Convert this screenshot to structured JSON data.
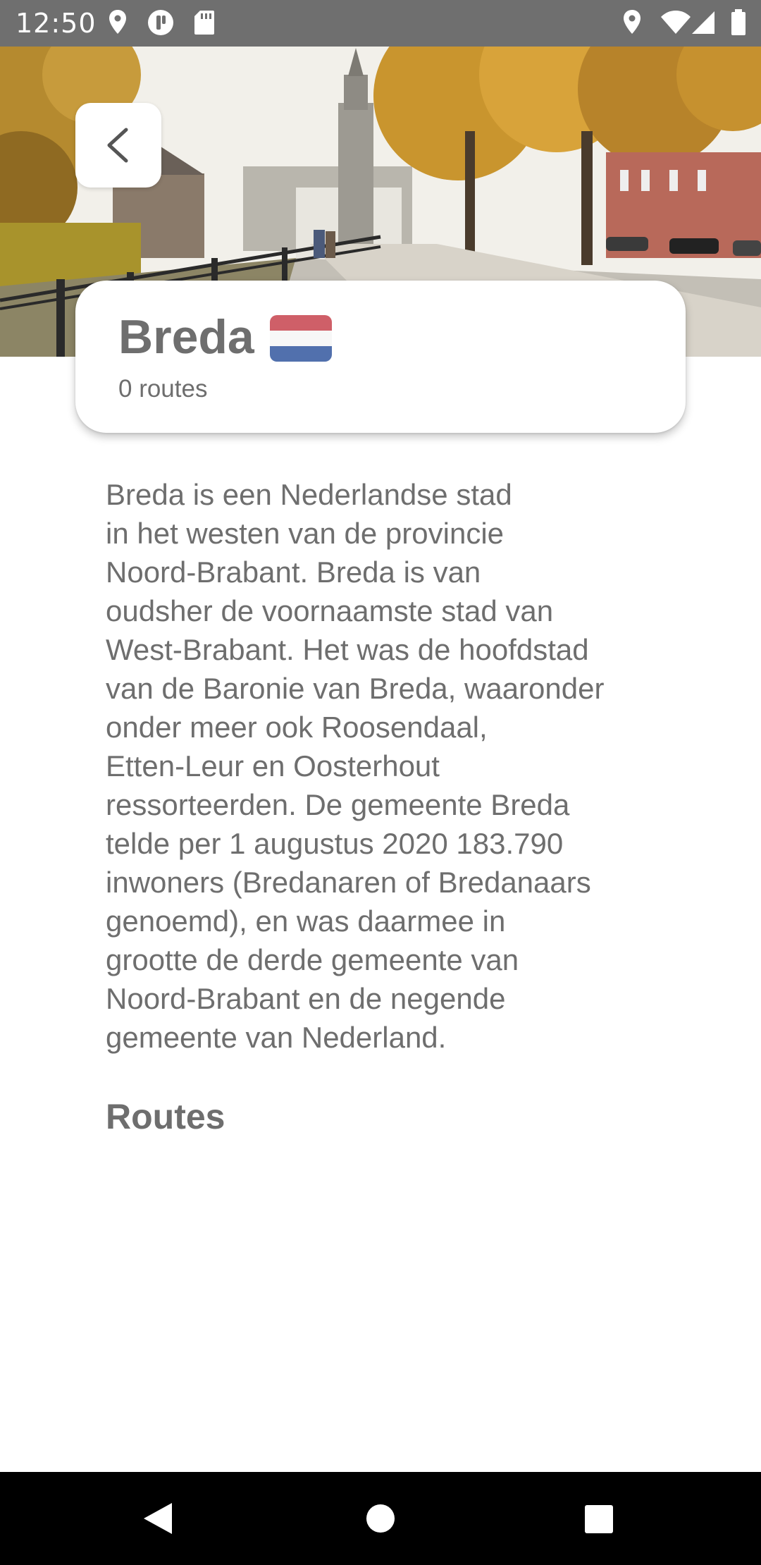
{
  "status_bar": {
    "time": "12:50",
    "left_icons": [
      "location-pin-icon",
      "app-notification-icon",
      "sd-card-icon"
    ],
    "right_icons": [
      "location-pin-icon",
      "wifi-icon",
      "signal-icon",
      "battery-icon"
    ]
  },
  "hero": {
    "image": "breda-city-photo",
    "back_icon": "chevron-left-icon"
  },
  "city": {
    "name": "Breda",
    "flag_icon": "netherlands-flag-icon",
    "route_count": "0 routes"
  },
  "description": "Breda is een Nederlandse stad\nin het westen van de provincie\nNoord-Brabant. Breda is van\noudsher de voornaamste stad van\nWest-Brabant. Het was de hoofdstad\nvan de Baronie van Breda, waaronder\nonder meer ook Roosendaal,\nEtten-Leur en Oosterhout\nressorteerden. De gemeente Breda\ntelde per 1 augustus 2020 183.790\ninwoners (Bredanaren of Bredanaars\ngenoemd), en was daarmee in\ngrootte de derde gemeente van\nNoord-Brabant en de negende\ngemeente van Nederland.",
  "routes_heading": "Routes",
  "nav_bar": {
    "icons": [
      "back-triangle-icon",
      "home-circle-icon",
      "recents-square-icon"
    ]
  },
  "colors": {
    "status_bar": "#6f6f6f",
    "text": "#6e6e6e",
    "nav_bar": "#000000",
    "flag_red": "#ae1c28",
    "flag_white": "#ffffff",
    "flag_blue": "#21468b"
  }
}
